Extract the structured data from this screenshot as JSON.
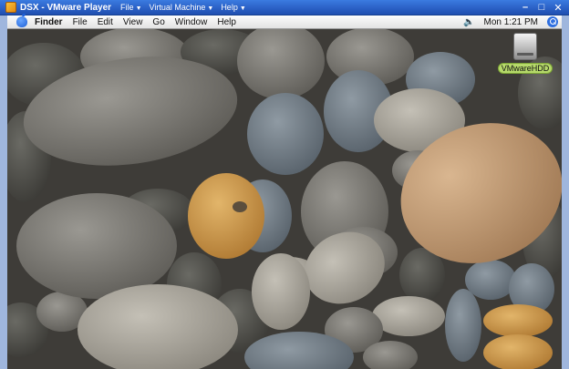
{
  "vm_window": {
    "title": "DSX - VMware Player",
    "menus": [
      {
        "label": "File"
      },
      {
        "label": "Virtual Machine"
      },
      {
        "label": "Help"
      }
    ],
    "controls": {
      "minimize": "–",
      "maximize": "□",
      "close": "✕"
    }
  },
  "mac_menubar": {
    "apple_icon": "apple-icon",
    "items": [
      {
        "label": "Finder"
      },
      {
        "label": "File"
      },
      {
        "label": "Edit"
      },
      {
        "label": "View"
      },
      {
        "label": "Go"
      },
      {
        "label": "Window"
      },
      {
        "label": "Help"
      }
    ],
    "speaker_icon": "speaker-icon",
    "clock": "Mon 1:21 PM",
    "spotlight_icon": "spotlight-icon"
  },
  "desktop": {
    "wallpaper": "pebble stones",
    "icons": [
      {
        "label": "VMwareHDD",
        "icon": "hard-drive-icon"
      }
    ]
  },
  "colors": {
    "title_bar": "#2a5fc4",
    "hdd_label_bg": "#b6d96a"
  }
}
